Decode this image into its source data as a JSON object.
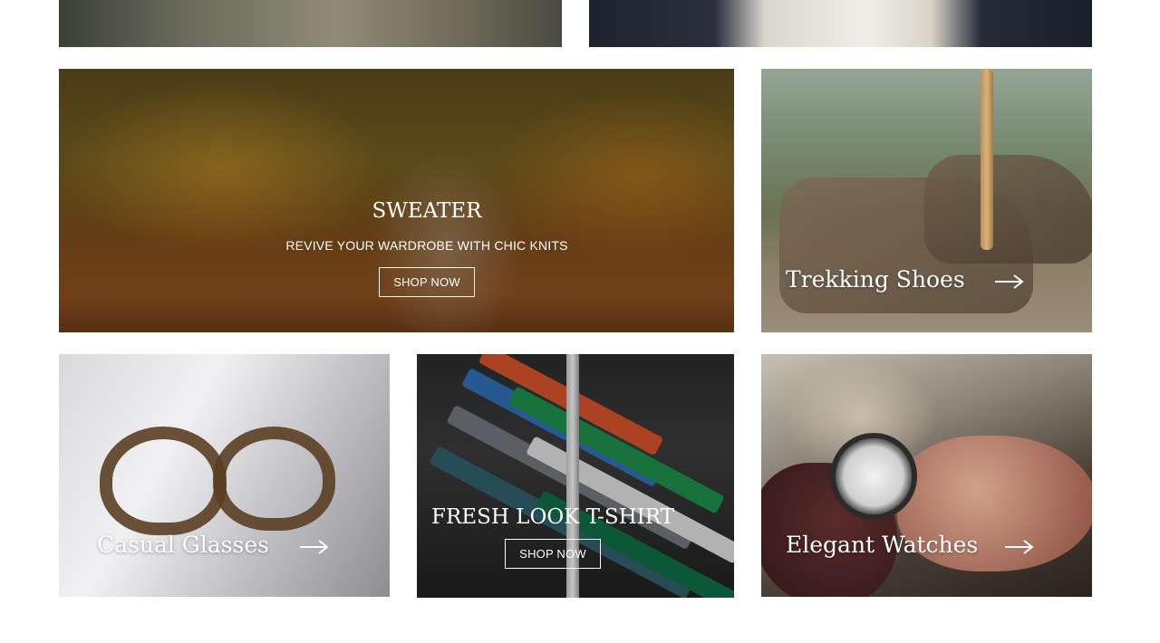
{
  "tiles": {
    "sweater": {
      "title": "SWEATER",
      "subtitle": "REVIVE YOUR WARDROBE WITH CHIC KNITS",
      "button": "SHOP NOW"
    },
    "trekking_shoes": {
      "title": "Trekking Shoes",
      "arrow_icon": "arrow-right-icon"
    },
    "casual_glasses": {
      "title": "Casual Glasses",
      "arrow_icon": "arrow-right-icon"
    },
    "fresh_look_tshirt": {
      "title": "FRESH LOOK T-SHIRT",
      "button": "SHOP NOW"
    },
    "elegant_watches": {
      "title": "Elegant Watches",
      "arrow_icon": "arrow-right-icon"
    }
  },
  "colors": {
    "text": "#ffffff",
    "background": "#ffffff"
  }
}
